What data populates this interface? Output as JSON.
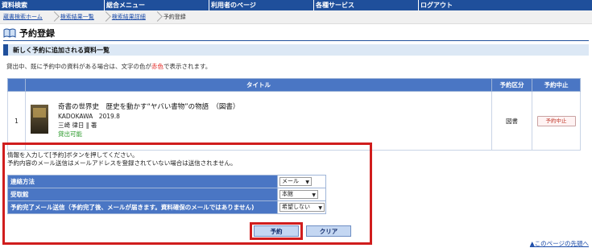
{
  "nav": {
    "items": [
      "資料検索",
      "総合メニュー",
      "利用者のページ",
      "各種サービス",
      "ログアウト"
    ]
  },
  "breadcrumb": {
    "items": [
      "蔵書検索ホーム",
      "検索結果一覧",
      "検索結果詳細"
    ],
    "current": "予約登録"
  },
  "page": {
    "title": "予約登録"
  },
  "section": {
    "header": "新しく予約に追加される資料一覧",
    "notice_before": "貸出中、既に予約中の資料がある場合は、文字の色が",
    "notice_red": "赤色",
    "notice_after": "で表示されます。"
  },
  "results": {
    "headers": {
      "num": "",
      "title": "タイトル",
      "type": "予約区分",
      "cancel": "予約中止"
    },
    "rows": [
      {
        "num": "1",
        "title": "奇書の世界史　歴史を動かす“ヤバい書物”の物語　（図書）",
        "publisher": "KADOKAWA　2019.8",
        "author": "三崎 律日 ‖ 著",
        "status": "貸出可能",
        "type": "図書",
        "cancel_label": "予約中止"
      }
    ]
  },
  "form": {
    "msg_line1": "情報を入力して[予約]ボタンを押してください。",
    "msg_line2": "予約内容のメール送信はメールアドレスを登録されていない場合は送信されません。",
    "contact": {
      "label": "連絡方法",
      "value": "メール"
    },
    "pickup": {
      "label": "受取館",
      "value": "本館"
    },
    "mail": {
      "label": "予約完了メール送信（予約完了後、メールが届きます。資料確保のメールではありません)",
      "value": "希望しない"
    },
    "reserve_label": "予約",
    "clear_label": "クリア"
  },
  "footer": {
    "pagetop": "▲このページの先頭へ"
  },
  "colors": {
    "nav_bg": "#1f4f9b",
    "table_header": "#4a76c4",
    "highlight": "#d01d1d",
    "available": "#2b9a2b"
  }
}
